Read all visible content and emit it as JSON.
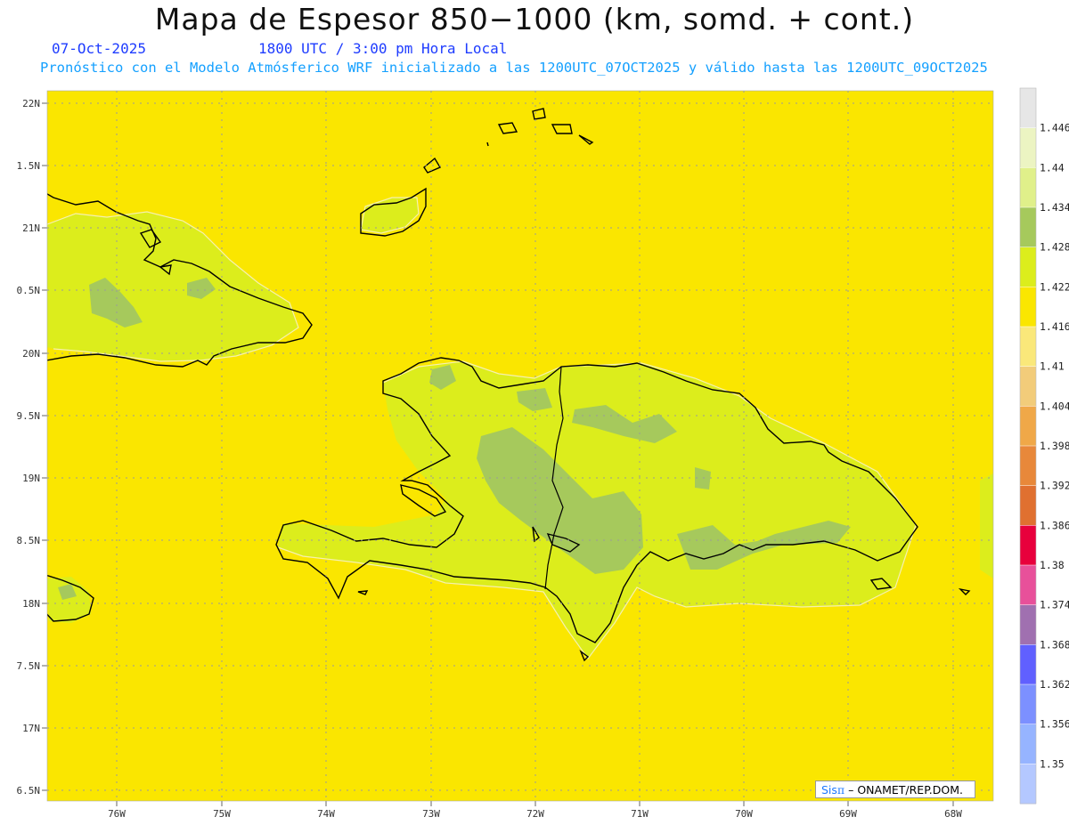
{
  "title": "Mapa de Espesor 850−1000 (km, somd. + cont.)",
  "date": "07-Oct-2025",
  "time": "1800 UTC / 3:00 pm Hora Local",
  "description": "Pronóstico con el Modelo Atmósferico WRF inicializado a las 1200UTC_07OCT2025 y válido hasta las  1200UTC_09OCT2025",
  "credit": {
    "sis": "Sis",
    "pi": "π",
    "org": "– ONAMET/REP.DOM."
  },
  "lat_labels": [
    "22N",
    "1.5N",
    "21N",
    "0.5N",
    "20N",
    "9.5N",
    "19N",
    "8.5N",
    "18N",
    "7.5N",
    "17N",
    "6.5N"
  ],
  "lon_labels": [
    "76W",
    "75W",
    "74W",
    "73W",
    "72W",
    "71W",
    "70W",
    "69W",
    "68W"
  ],
  "colorbar": {
    "labels": [
      "1.446",
      "1.44",
      "1.434",
      "1.428",
      "1.422",
      "1.416",
      "1.41",
      "1.404",
      "1.398",
      "1.392",
      "1.386",
      "1.38",
      "1.374",
      "1.368",
      "1.362",
      "1.356",
      "1.35"
    ],
    "colors": [
      "#e6e6e6",
      "#ecf4c2",
      "#e0f08a",
      "#a6c95c",
      "#dced1c",
      "#fae600",
      "#fae87a",
      "#f2cc7a",
      "#f0a848",
      "#e8883a",
      "#e07030",
      "#e8003c",
      "#e8509a",
      "#a070b0",
      "#6060ff",
      "#7c90ff",
      "#96b4ff",
      "#b4c8ff"
    ]
  },
  "field_colors": {
    "base": "#fae600",
    "mid": "#dced1c",
    "high": "#a6c95c",
    "contour": "#f6f0b0",
    "coast": "#000000"
  }
}
